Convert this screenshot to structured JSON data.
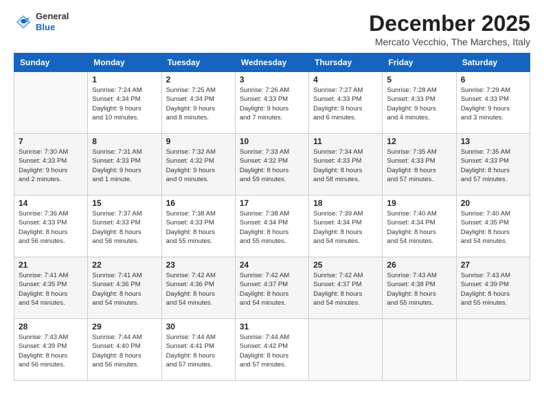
{
  "logo": {
    "general": "General",
    "blue": "Blue"
  },
  "header": {
    "month": "December 2025",
    "location": "Mercato Vecchio, The Marches, Italy"
  },
  "days": [
    "Sunday",
    "Monday",
    "Tuesday",
    "Wednesday",
    "Thursday",
    "Friday",
    "Saturday"
  ],
  "weeks": [
    [
      {
        "day": "",
        "info": ""
      },
      {
        "day": "1",
        "info": "Sunrise: 7:24 AM\nSunset: 4:34 PM\nDaylight: 9 hours\nand 10 minutes."
      },
      {
        "day": "2",
        "info": "Sunrise: 7:25 AM\nSunset: 4:34 PM\nDaylight: 9 hours\nand 8 minutes."
      },
      {
        "day": "3",
        "info": "Sunrise: 7:26 AM\nSunset: 4:33 PM\nDaylight: 9 hours\nand 7 minutes."
      },
      {
        "day": "4",
        "info": "Sunrise: 7:27 AM\nSunset: 4:33 PM\nDaylight: 9 hours\nand 6 minutes."
      },
      {
        "day": "5",
        "info": "Sunrise: 7:28 AM\nSunset: 4:33 PM\nDaylight: 9 hours\nand 4 minutes."
      },
      {
        "day": "6",
        "info": "Sunrise: 7:29 AM\nSunset: 4:33 PM\nDaylight: 9 hours\nand 3 minutes."
      }
    ],
    [
      {
        "day": "7",
        "info": "Sunrise: 7:30 AM\nSunset: 4:33 PM\nDaylight: 9 hours\nand 2 minutes."
      },
      {
        "day": "8",
        "info": "Sunrise: 7:31 AM\nSunset: 4:33 PM\nDaylight: 9 hours\nand 1 minute."
      },
      {
        "day": "9",
        "info": "Sunrise: 7:32 AM\nSunset: 4:32 PM\nDaylight: 9 hours\nand 0 minutes."
      },
      {
        "day": "10",
        "info": "Sunrise: 7:33 AM\nSunset: 4:32 PM\nDaylight: 8 hours\nand 59 minutes."
      },
      {
        "day": "11",
        "info": "Sunrise: 7:34 AM\nSunset: 4:33 PM\nDaylight: 8 hours\nand 58 minutes."
      },
      {
        "day": "12",
        "info": "Sunrise: 7:35 AM\nSunset: 4:33 PM\nDaylight: 8 hours\nand 57 minutes."
      },
      {
        "day": "13",
        "info": "Sunrise: 7:35 AM\nSunset: 4:33 PM\nDaylight: 8 hours\nand 57 minutes."
      }
    ],
    [
      {
        "day": "14",
        "info": "Sunrise: 7:36 AM\nSunset: 4:33 PM\nDaylight: 8 hours\nand 56 minutes."
      },
      {
        "day": "15",
        "info": "Sunrise: 7:37 AM\nSunset: 4:33 PM\nDaylight: 8 hours\nand 56 minutes."
      },
      {
        "day": "16",
        "info": "Sunrise: 7:38 AM\nSunset: 4:33 PM\nDaylight: 8 hours\nand 55 minutes."
      },
      {
        "day": "17",
        "info": "Sunrise: 7:38 AM\nSunset: 4:34 PM\nDaylight: 8 hours\nand 55 minutes."
      },
      {
        "day": "18",
        "info": "Sunrise: 7:39 AM\nSunset: 4:34 PM\nDaylight: 8 hours\nand 54 minutes."
      },
      {
        "day": "19",
        "info": "Sunrise: 7:40 AM\nSunset: 4:34 PM\nDaylight: 8 hours\nand 54 minutes."
      },
      {
        "day": "20",
        "info": "Sunrise: 7:40 AM\nSunset: 4:35 PM\nDaylight: 8 hours\nand 54 minutes."
      }
    ],
    [
      {
        "day": "21",
        "info": "Sunrise: 7:41 AM\nSunset: 4:35 PM\nDaylight: 8 hours\nand 54 minutes."
      },
      {
        "day": "22",
        "info": "Sunrise: 7:41 AM\nSunset: 4:36 PM\nDaylight: 8 hours\nand 54 minutes."
      },
      {
        "day": "23",
        "info": "Sunrise: 7:42 AM\nSunset: 4:36 PM\nDaylight: 8 hours\nand 54 minutes."
      },
      {
        "day": "24",
        "info": "Sunrise: 7:42 AM\nSunset: 4:37 PM\nDaylight: 8 hours\nand 54 minutes."
      },
      {
        "day": "25",
        "info": "Sunrise: 7:42 AM\nSunset: 4:37 PM\nDaylight: 8 hours\nand 54 minutes."
      },
      {
        "day": "26",
        "info": "Sunrise: 7:43 AM\nSunset: 4:38 PM\nDaylight: 8 hours\nand 55 minutes."
      },
      {
        "day": "27",
        "info": "Sunrise: 7:43 AM\nSunset: 4:39 PM\nDaylight: 8 hours\nand 55 minutes."
      }
    ],
    [
      {
        "day": "28",
        "info": "Sunrise: 7:43 AM\nSunset: 4:39 PM\nDaylight: 8 hours\nand 56 minutes."
      },
      {
        "day": "29",
        "info": "Sunrise: 7:44 AM\nSunset: 4:40 PM\nDaylight: 8 hours\nand 56 minutes."
      },
      {
        "day": "30",
        "info": "Sunrise: 7:44 AM\nSunset: 4:41 PM\nDaylight: 8 hours\nand 57 minutes."
      },
      {
        "day": "31",
        "info": "Sunrise: 7:44 AM\nSunset: 4:42 PM\nDaylight: 8 hours\nand 57 minutes."
      },
      {
        "day": "",
        "info": ""
      },
      {
        "day": "",
        "info": ""
      },
      {
        "day": "",
        "info": ""
      }
    ]
  ]
}
